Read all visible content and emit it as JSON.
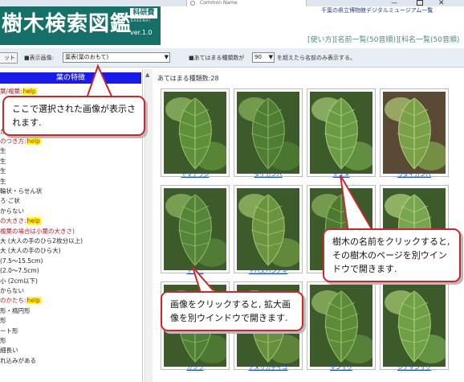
{
  "browser": {
    "tab_label": "Common Name"
  },
  "header": {
    "site_title": "樹木検索図鑑",
    "badge": "科研費",
    "badge_sub": "KAKENHI",
    "version": "ver.1.0",
    "org": "千葉の県立博物館デジタルミュージアム一覧",
    "nav": "[使い方][名前一覧(50音順)][科名一覧(50音順)"
  },
  "toolbar": {
    "reset_label": "ット",
    "display_label": "■表示画像:",
    "display_value": "葉表(葉のおもて)",
    "limit_label": "■あてはまる種類数が",
    "count_value": "90",
    "limit_suffix": "を超えたら名前のみ表示する。"
  },
  "left_panel": {
    "header": "葉の特徴",
    "lines": [
      {
        "text": "葉/複葉:",
        "help": "help",
        "red": true
      },
      {
        "text": "",
        "help": "",
        "red": false
      },
      {
        "text": "",
        "help": "",
        "red": false
      },
      {
        "text": "",
        "help": "",
        "red": false
      },
      {
        "text": "からない",
        "help": "",
        "red": false
      },
      {
        "text": "のつき方:",
        "help": "help",
        "red": true
      },
      {
        "text": "生",
        "help": "",
        "red": false
      },
      {
        "text": "生",
        "help": "",
        "red": false
      },
      {
        "text": "生",
        "help": "",
        "red": false
      },
      {
        "text": "生",
        "help": "",
        "red": false
      },
      {
        "text": "輪状・らせん状",
        "help": "",
        "red": false
      },
      {
        "text": "ろ·ご状",
        "help": "",
        "red": false
      },
      {
        "text": "からない",
        "help": "",
        "red": false
      },
      {
        "text": "の大きさ:",
        "help": "help",
        "red": true
      },
      {
        "text": "複葉の場合は小葉の大きさ)",
        "help": "",
        "red": true
      },
      {
        "text": "大 (大人の手のひら2枚分以上)",
        "help": "",
        "red": false
      },
      {
        "text": "大 (大人の手のひら大)",
        "help": "",
        "red": false
      },
      {
        "text": "(7.5〜15.5cm)",
        "help": "",
        "red": false
      },
      {
        "text": "(2.0〜7.5cm)",
        "help": "",
        "red": false
      },
      {
        "text": "小 (2cm以下)",
        "help": "",
        "red": false
      },
      {
        "text": "からない",
        "help": "",
        "red": false
      },
      {
        "text": "のかたち:",
        "help": "help",
        "red": true
      },
      {
        "text": "形・楕円形",
        "help": "",
        "red": false
      },
      {
        "text": "形",
        "help": "",
        "red": false
      },
      {
        "text": "ート形",
        "help": "",
        "red": false
      },
      {
        "text": "形",
        "help": "",
        "red": false
      },
      {
        "text": "細長い",
        "help": "",
        "red": false
      },
      {
        "text": "れ込みがある",
        "help": "",
        "red": false
      }
    ]
  },
  "results": {
    "count_label": "あてはまる種類数:28",
    "items": [
      {
        "name": "ヤマナラシ"
      },
      {
        "name": "ダケカンバ"
      },
      {
        "name": "ミズメ"
      },
      {
        "name": "ウダイカンバ"
      },
      {
        "name": "ヤマ..."
      },
      {
        "name": "ヤハズハンノキ"
      },
      {
        "name": ""
      },
      {
        "name": ""
      },
      {
        "name": ""
      },
      {
        "name": "カツラ"
      },
      {
        "name": "アメリカデイゴ"
      },
      {
        "name": "マンサク"
      },
      {
        "name": "シナマンサク"
      }
    ]
  },
  "callouts": {
    "select_hint": "ここで選択された画像が表示されます.",
    "name_hint": "樹木の名前をクリックすると, その樹木のページを別ウインドウで開きます.",
    "image_hint": "画像をクリックすると, 拡大画像を別ウインドウで開きます."
  },
  "colors": {
    "logo_band": "#16706a",
    "feature_header": "#1a1aee",
    "callout_border": "#c8282a",
    "link": "#2050c0",
    "help_bg": "#ffff00"
  }
}
